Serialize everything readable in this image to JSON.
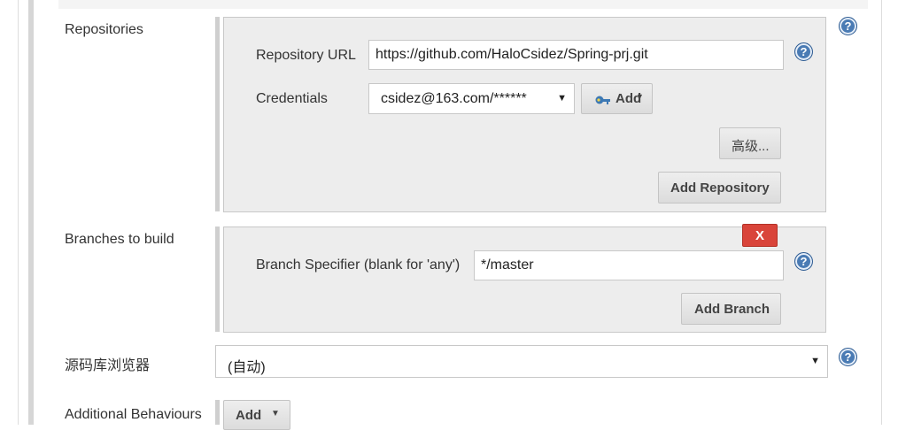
{
  "repositories": {
    "label": "Repositories",
    "url_label": "Repository URL",
    "url_value": "https://github.com/HaloCsidez/Spring-prj.git",
    "credentials_label": "Credentials",
    "credentials_value": "csidez@163.com/******",
    "credentials_add_label": "Add",
    "advanced_label": "高级...",
    "add_repository_label": "Add Repository"
  },
  "branches": {
    "label": "Branches to build",
    "delete_label": "X",
    "specifier_label": "Branch Specifier (blank for 'any')",
    "specifier_value": "*/master",
    "add_branch_label": "Add Branch"
  },
  "browser": {
    "label": "源码库浏览器",
    "value": "(自动)"
  },
  "behaviours": {
    "label": "Additional Behaviours",
    "add_label": "Add"
  },
  "help_glyph": "?",
  "icons": {
    "help": "help-icon",
    "dropdown": "dropdown-arrow-icon",
    "key": "key-icon"
  }
}
